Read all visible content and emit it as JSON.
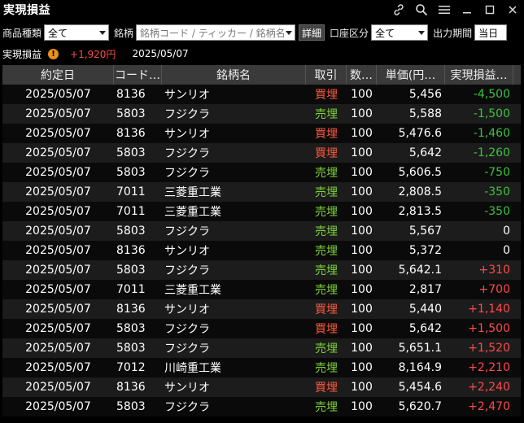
{
  "window": {
    "title": "実現損益"
  },
  "filters": {
    "product_label": "商品種類",
    "product_value": "全て",
    "stock_label": "銘柄",
    "stock_placeholder": "銘柄コード / ティッカー / 銘柄名",
    "detail_button": "詳細",
    "account_label": "口座区分",
    "account_value": "全て",
    "period_label": "出力期間",
    "period_value": "当日"
  },
  "summary": {
    "label": "実現損益",
    "warning": "!",
    "total": "+1,920円",
    "date": "2025/05/07"
  },
  "table": {
    "headers": [
      "約定日",
      "コード…",
      "銘柄名",
      "取引",
      "数…",
      "単価(円…",
      "実現損益…"
    ],
    "rows": [
      {
        "date": "2025/05/07",
        "code": "8136",
        "name": "サンリオ",
        "trade": "買埋",
        "qty": "100",
        "price": "5,456",
        "pl": "-4,500"
      },
      {
        "date": "2025/05/07",
        "code": "5803",
        "name": "フジクラ",
        "trade": "売埋",
        "qty": "100",
        "price": "5,588",
        "pl": "-1,500"
      },
      {
        "date": "2025/05/07",
        "code": "8136",
        "name": "サンリオ",
        "trade": "買埋",
        "qty": "100",
        "price": "5,476.6",
        "pl": "-1,460"
      },
      {
        "date": "2025/05/07",
        "code": "5803",
        "name": "フジクラ",
        "trade": "買埋",
        "qty": "100",
        "price": "5,642",
        "pl": "-1,260"
      },
      {
        "date": "2025/05/07",
        "code": "5803",
        "name": "フジクラ",
        "trade": "売埋",
        "qty": "100",
        "price": "5,606.5",
        "pl": "-750"
      },
      {
        "date": "2025/05/07",
        "code": "7011",
        "name": "三菱重工業",
        "trade": "売埋",
        "qty": "100",
        "price": "2,808.5",
        "pl": "-350"
      },
      {
        "date": "2025/05/07",
        "code": "7011",
        "name": "三菱重工業",
        "trade": "売埋",
        "qty": "100",
        "price": "2,813.5",
        "pl": "-350"
      },
      {
        "date": "2025/05/07",
        "code": "5803",
        "name": "フジクラ",
        "trade": "売埋",
        "qty": "100",
        "price": "5,567",
        "pl": "0"
      },
      {
        "date": "2025/05/07",
        "code": "8136",
        "name": "サンリオ",
        "trade": "売埋",
        "qty": "100",
        "price": "5,372",
        "pl": "0"
      },
      {
        "date": "2025/05/07",
        "code": "5803",
        "name": "フジクラ",
        "trade": "売埋",
        "qty": "100",
        "price": "5,642.1",
        "pl": "+310"
      },
      {
        "date": "2025/05/07",
        "code": "7011",
        "name": "三菱重工業",
        "trade": "売埋",
        "qty": "100",
        "price": "2,817",
        "pl": "+700"
      },
      {
        "date": "2025/05/07",
        "code": "8136",
        "name": "サンリオ",
        "trade": "買埋",
        "qty": "100",
        "price": "5,440",
        "pl": "+1,140"
      },
      {
        "date": "2025/05/07",
        "code": "5803",
        "name": "フジクラ",
        "trade": "買埋",
        "qty": "100",
        "price": "5,642",
        "pl": "+1,500"
      },
      {
        "date": "2025/05/07",
        "code": "5803",
        "name": "フジクラ",
        "trade": "売埋",
        "qty": "100",
        "price": "5,651.1",
        "pl": "+1,520"
      },
      {
        "date": "2025/05/07",
        "code": "7012",
        "name": "川崎重工業",
        "trade": "売埋",
        "qty": "100",
        "price": "8,164.9",
        "pl": "+2,210"
      },
      {
        "date": "2025/05/07",
        "code": "8136",
        "name": "サンリオ",
        "trade": "買埋",
        "qty": "100",
        "price": "5,454.6",
        "pl": "+2,240"
      },
      {
        "date": "2025/05/07",
        "code": "5803",
        "name": "フジクラ",
        "trade": "売埋",
        "qty": "100",
        "price": "5,620.7",
        "pl": "+2,470"
      }
    ]
  },
  "colors": {
    "profit": "#ff4a4a",
    "loss": "#3ec13e",
    "buy": "#ff5a3c",
    "sell": "#7ed33a",
    "header_bg": "#3a3a3a"
  },
  "icons": [
    "link-icon",
    "search-icon",
    "menu-icon",
    "minimize-icon",
    "maximize-icon",
    "close-icon",
    "warning-icon",
    "chevron-down-icon"
  ]
}
